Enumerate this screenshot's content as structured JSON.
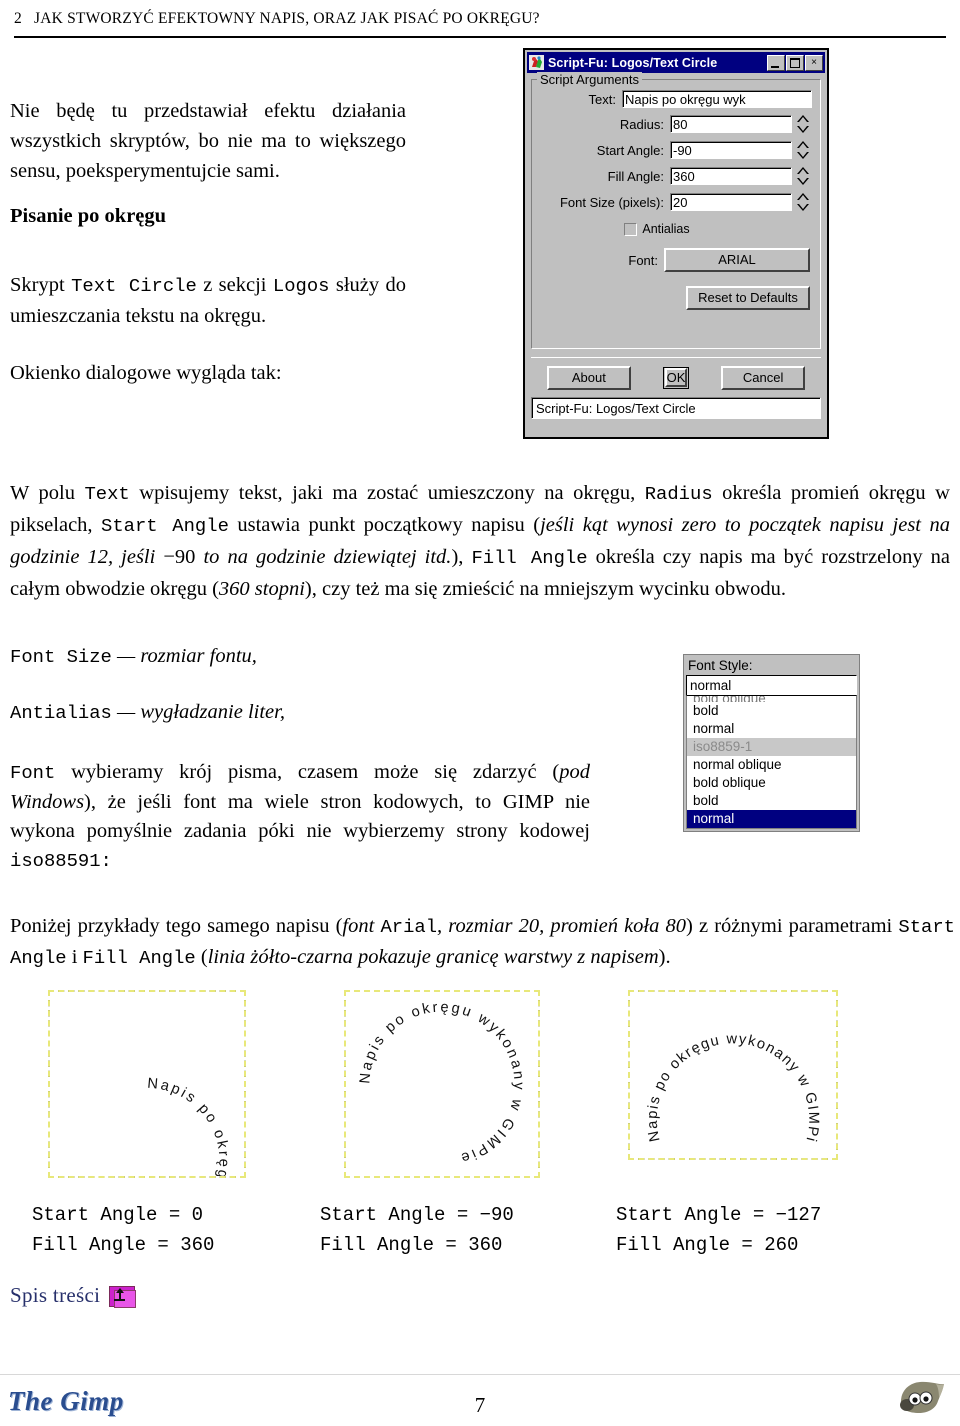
{
  "header": {
    "chapter_number": "2",
    "title": "JAK STWORZYĆ EFEKTOWNY NAPIS, ORAZ JAK PISAĆ PO OKRĘGU?"
  },
  "intro": {
    "paragraph": "Nie będę tu przedstawiał efektu działania wszystkich skryptów, bo nie ma to większego sensu, poeksperymentujcie sami.",
    "section_heading": "Pisanie po okręgu",
    "skrypt_pre": "Skrypt ",
    "skrypt_code1": "Text Circle",
    "skrypt_mid": " z sekcji ",
    "skrypt_code2": "Logos",
    "skrypt_post": " służy do umieszczania tekstu na okręgu.",
    "okienko": "Okienko dialogowe wygląda tak:"
  },
  "dialog": {
    "icon_name": "script-fu-icon",
    "title": "Script-Fu: Logos/Text Circle",
    "minimize_label": "_",
    "maximize_label": "□",
    "close_label": "×",
    "group_legend": "Script Arguments",
    "fields": [
      {
        "label": "Text:",
        "value": "Napis po okręgu wyk",
        "has_spinner": false,
        "kind": "text"
      },
      {
        "label": "Radius:",
        "value": "80",
        "has_spinner": true,
        "kind": "num"
      },
      {
        "label": "Start Angle:",
        "value": "-90",
        "has_spinner": true,
        "kind": "num"
      },
      {
        "label": "Fill Angle:",
        "value": "360",
        "has_spinner": true,
        "kind": "num"
      },
      {
        "label": "Font Size (pixels):",
        "value": "20",
        "has_spinner": true,
        "kind": "num"
      }
    ],
    "antialias_label": "Antialias",
    "antialias_checked": false,
    "font_label": "Font:",
    "font_value": "ARIAL",
    "reset_label": "Reset to Defaults",
    "about_label": "About",
    "ok_label": "OK",
    "cancel_label": "Cancel",
    "statusbar": "Script-Fu: Logos/Text Circle",
    "titlebar_color": "#000080",
    "face_color": "#c0c0c0"
  },
  "body": {
    "p1_a": "W polu ",
    "p1_code_text": "Text",
    "p1_b": " wpisujemy tekst, jaki ma zostać umieszczony na okręgu, ",
    "p1_code_radius": "Radius",
    "p1_c": " określa promień okręgu w pikselach, ",
    "p1_code_startangle": "Start Angle",
    "p1_d": " ustawia punkt początkowy napisu (",
    "p1_ital1": "jeśli kąt wynosi zero to początek napisu jest na godzinie 12, jeśli ",
    "p1_minus90": "−90",
    "p1_ital2": " to na godzinie dziewiątej itd.",
    "p1_e": "), ",
    "p1_code_fillangle": "Fill Angle",
    "p1_f": " określa czy napis ma być rozstrzelony na całym obwodzie okręgu (",
    "p1_ital3": "360 stopni",
    "p1_g": "), czy też ma się zmieścić na mniejszym wycinku obwodu."
  },
  "definitions": {
    "fontsize_code": "Font Size",
    "fontsize_desc": " — rozmiar fontu,",
    "antialias_code": "Antialias",
    "antialias_desc": " — wygładzanie liter,",
    "font_code": "Font",
    "font_desc_a": " wybieramy krój pisma, czasem może się zdarzyć (",
    "font_desc_ital": "pod Windows",
    "font_desc_b": "), że jeśli font ma wiele stron kodowych, to GIMP nie wykona pomyślnie zadania póki nie wybierzemy strony kodowej ",
    "font_desc_code": "iso88591:"
  },
  "font_style_widget": {
    "label": "Font Style:",
    "entry_value": "normal",
    "items": [
      {
        "text": "bold oblique",
        "state": "clipped"
      },
      {
        "text": "bold",
        "state": "normal"
      },
      {
        "text": "normal",
        "state": "normal"
      },
      {
        "text": "iso8859-1",
        "state": "greyed"
      },
      {
        "text": "normal oblique",
        "state": "normal"
      },
      {
        "text": "bold oblique",
        "state": "normal"
      },
      {
        "text": "bold",
        "state": "normal"
      },
      {
        "text": "normal",
        "state": "selected"
      }
    ],
    "selected_color": "#000080"
  },
  "examples_lead": {
    "a": "Poniżej przykłady tego samego napisu (",
    "ital_font": "font ",
    "code_arial": "Arial",
    "ital_rest": ", rozmiar 20, promień koła 80",
    "b": ") z różnymi parametrami ",
    "code_startangle": "Start Angle",
    "c": " i ",
    "code_fillangle": "Fill Angle",
    "d": " (",
    "ital_legend": "linia żółto-czarna pokazuje granicę warstwy z napisem",
    "e": ")."
  },
  "examples": [
    {
      "id": "example-1",
      "circle_text": "Napis po okręgu wykonany w GIMPie",
      "start_angle": 0,
      "fill_angle": 360,
      "caption_line1": "Start Angle = 0",
      "caption_line2": "Fill Angle = 360"
    },
    {
      "id": "example-2",
      "circle_text": "Napis po okręgu wykonany w GIMPie",
      "start_angle": -90,
      "fill_angle": 360,
      "caption_line1": "Start Angle = −90",
      "caption_line2": "Fill Angle = 360"
    },
    {
      "id": "example-3",
      "circle_text": "Napis po okręgu wykonany w GIMPie",
      "start_angle": -127,
      "fill_angle": 260,
      "caption_line1": "Start Angle = −127",
      "caption_line2": "Fill Angle = 260"
    }
  ],
  "footer": {
    "toc_label": "Spis treści",
    "toc_icon_name": "folder-up-icon",
    "toc_color": "#27306b",
    "logo_text": "The Gimp",
    "logo_color": "#2a4d8f",
    "page_number": "7",
    "mascot_icon_name": "wilber-mascot-icon"
  }
}
